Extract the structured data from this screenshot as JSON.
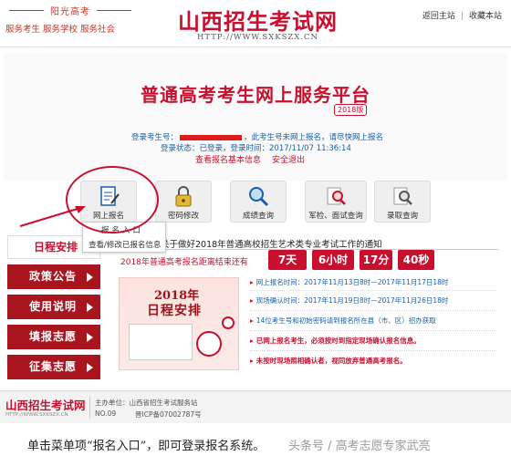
{
  "header": {
    "motto_top": "阳光高考",
    "motto_bottom": "服务考生  服务学校  服务社会",
    "site_title": "山西招生考试网",
    "site_url": "HTTP://WWW.SXKSZX.CN",
    "link_home": "返回主站",
    "link_fav": "收藏本站",
    "sep": "|"
  },
  "banner": {
    "platform_title": "普通高考考生网上服务平台",
    "year_badge": "2018版",
    "login_prefix": "登录考生号：",
    "login_suffix": "，此考生号未网上报名，请尽快网上报名",
    "status_line": "登录状态：已登录，登录时间：2017/11/07 11:36:14",
    "link_check": "查看报名基本信息",
    "link_logout": "安全退出"
  },
  "menu": {
    "items": [
      {
        "label": "网上报名",
        "icon": "edit-form-icon"
      },
      {
        "label": "密码修改",
        "icon": "lock-icon"
      },
      {
        "label": "成绩查询",
        "icon": "magnifier-icon"
      },
      {
        "label": "军检、面试查询",
        "icon": "magnifier-doc-icon"
      },
      {
        "label": "录取查询",
        "icon": "magnifier-doc-icon"
      }
    ],
    "dropdown": [
      "报名入口",
      "查看/修改已报名信息"
    ]
  },
  "sidebar": {
    "heading": "日程安排",
    "buttons": [
      "政策公告",
      "使用说明",
      "填报志愿",
      "征集志愿"
    ]
  },
  "content": {
    "notice": "关于做好2018年普通高校招生艺术类专业考试工作的通知",
    "countdown_label": "2018年普通高考报名距离结束还有",
    "countdown": [
      "7天",
      "6小时",
      "17分",
      "40秒"
    ],
    "schedule_year": "2018年",
    "schedule_text": "日程安排",
    "bullets": [
      "网上报名时间：2017年11月13日8时—2017年11月17日18时",
      "现场确认时间：2017年11月19日8时—2017年11月26日18时",
      "14位考生号和初始密码请到报名所在县（市、区）招办获取",
      "已网上报名考生，必须按时到指定现场确认报名信息。",
      "未按时现场照相确认者，视同放弃普通高考报名。"
    ]
  },
  "footer": {
    "logo": "山西招生考试网",
    "url": "HTTP://WWW.SXKSZX.CN",
    "host": "主办单位：山西省招生考试服务站",
    "no": "NO.09",
    "icp": "晋ICP备07002787号"
  },
  "caption": {
    "text": "单击菜单项“报名入口”，即可登录报名系统。",
    "watermark": "头条号 / 高考志愿专家武亮"
  },
  "colors": {
    "brand_red": "#c8102e",
    "sidebar_red": "#a8151e",
    "link_blue": "#1a5ea8"
  }
}
